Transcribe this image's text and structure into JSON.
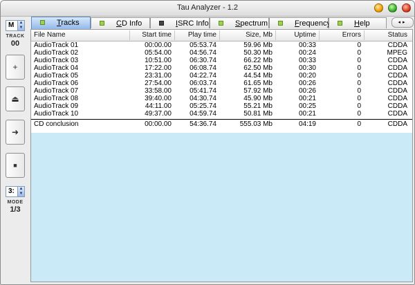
{
  "window": {
    "title": "Tau Analyzer - 1.2"
  },
  "left_panel": {
    "mode_value": "M",
    "track_label": "TRACK",
    "track_value": "00",
    "speed_value": "3:",
    "mode_label": "MODE",
    "mode_fraction": "1/3",
    "buttons": [
      {
        "name": "add",
        "glyph": "+"
      },
      {
        "name": "eject",
        "glyph": "⏏"
      },
      {
        "name": "play",
        "glyph": "➜"
      },
      {
        "name": "stop",
        "glyph": "■"
      }
    ]
  },
  "tabs": [
    {
      "label": "Tracks",
      "active": true,
      "icon": "green-square"
    },
    {
      "label": "CD Info",
      "active": false,
      "icon": "green-square"
    },
    {
      "label": "ISRC Info",
      "active": false,
      "icon": "dark-square"
    },
    {
      "label": "Spectrum",
      "active": false,
      "icon": "green-square"
    },
    {
      "label": "Frequency",
      "active": false,
      "icon": "green-square"
    },
    {
      "label": "Help",
      "active": false,
      "icon": "green-square"
    }
  ],
  "tab_scroll": "◂▸",
  "table": {
    "columns": [
      "File Name",
      "Start time",
      "Play time",
      "Size, Mb",
      "Uptime",
      "Errors",
      "Status"
    ],
    "rows": [
      [
        "AudioTrack 01",
        "00:00.00",
        "05:53.74",
        "59.96 Mb",
        "00:33",
        "0",
        "CDDA"
      ],
      [
        "AudioTrack 02",
        "05:54.00",
        "04:56.74",
        "50.30 Mb",
        "00:24",
        "0",
        "MPEG"
      ],
      [
        "AudioTrack 03",
        "10:51.00",
        "06:30.74",
        "66.22 Mb",
        "00:33",
        "0",
        "CDDA"
      ],
      [
        "AudioTrack 04",
        "17:22.00",
        "06:08.74",
        "62.50 Mb",
        "00:30",
        "0",
        "CDDA"
      ],
      [
        "AudioTrack 05",
        "23:31.00",
        "04:22.74",
        "44.54 Mb",
        "00:20",
        "0",
        "CDDA"
      ],
      [
        "AudioTrack 06",
        "27:54.00",
        "06:03.74",
        "61.65 Mb",
        "00:26",
        "0",
        "CDDA"
      ],
      [
        "AudioTrack 07",
        "33:58.00",
        "05:41.74",
        "57.92 Mb",
        "00:26",
        "0",
        "CDDA"
      ],
      [
        "AudioTrack 08",
        "39:40.00",
        "04:30.74",
        "45.90 Mb",
        "00:21",
        "0",
        "CDDA"
      ],
      [
        "AudioTrack 09",
        "44:11.00",
        "05:25.74",
        "55.21 Mb",
        "00:25",
        "0",
        "CDDA"
      ],
      [
        "AudioTrack 10",
        "49:37.00",
        "04:59.74",
        "50.81 Mb",
        "00:21",
        "0",
        "CDDA"
      ]
    ],
    "conclusion": [
      "CD conclusion",
      "00:00.00",
      "54:36.74",
      "555.03 Mb",
      "04:19",
      "0",
      "CDDA"
    ]
  }
}
